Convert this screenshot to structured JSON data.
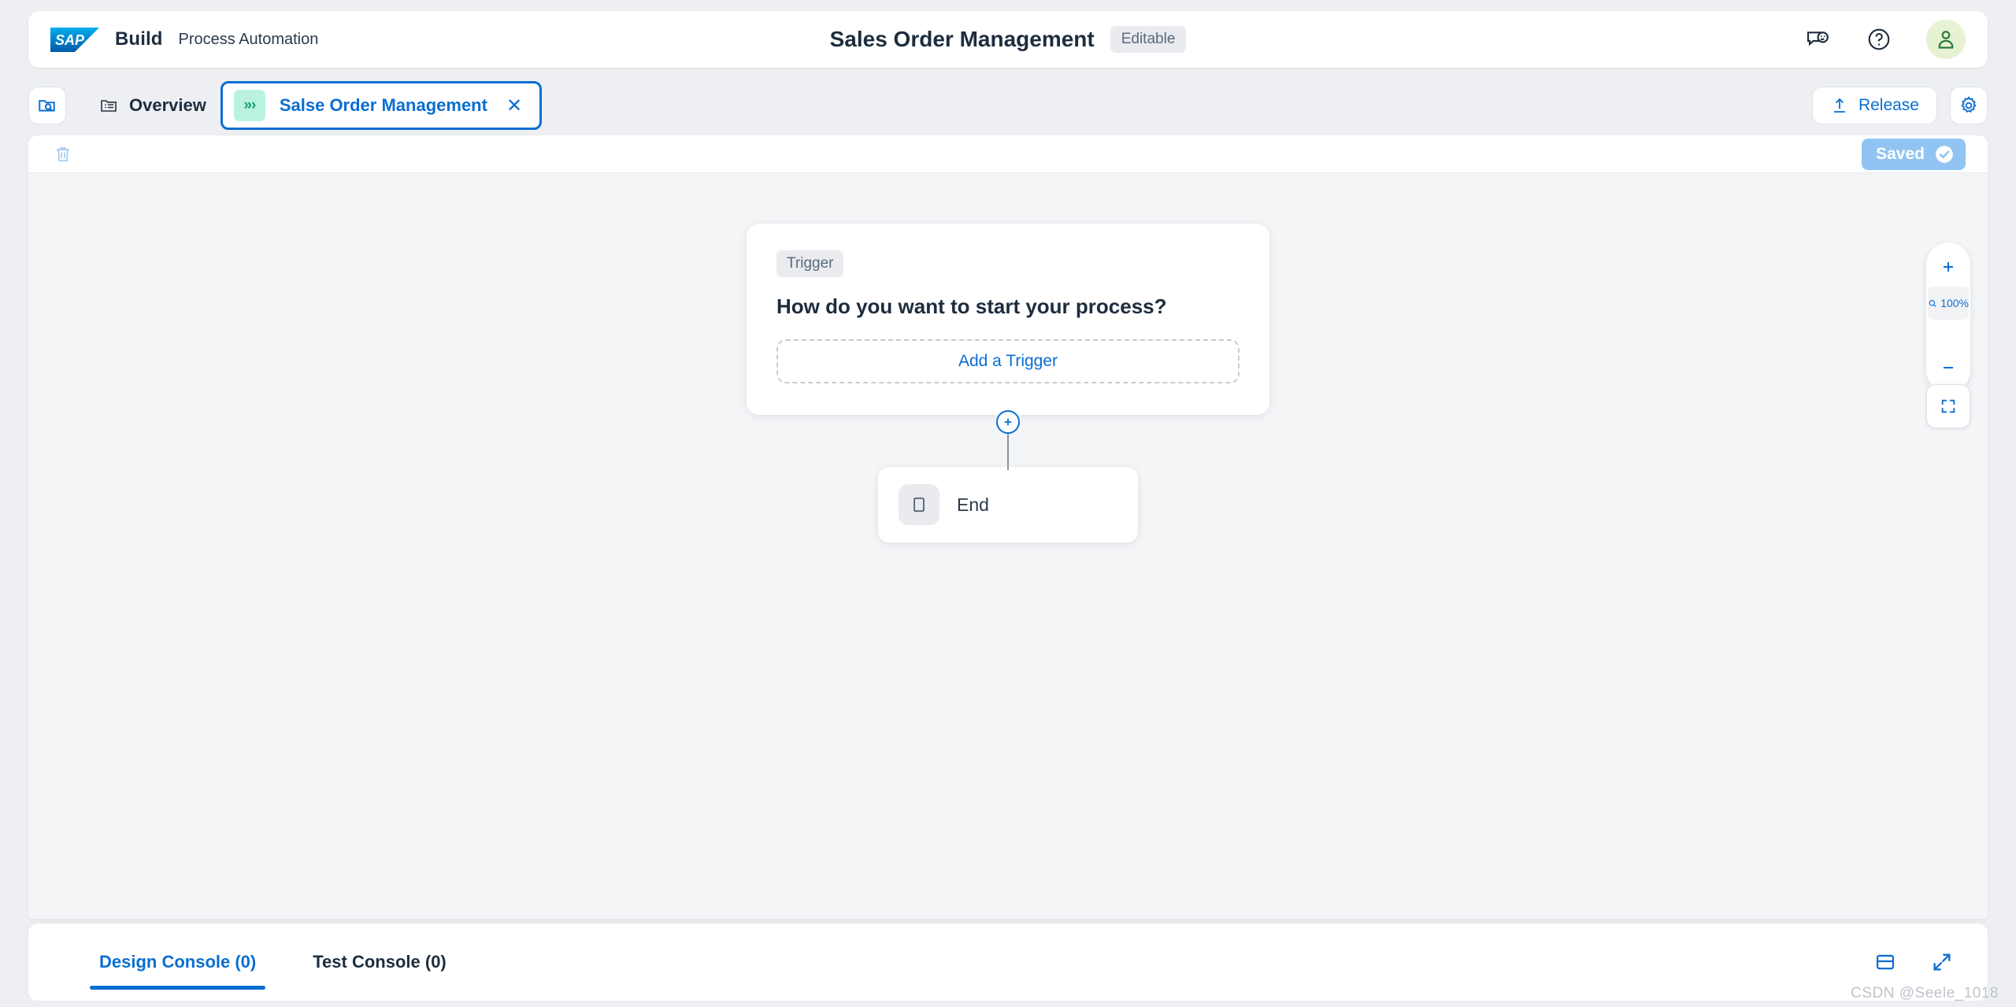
{
  "header": {
    "logo_alt": "SAP",
    "brand_name": "Build",
    "brand_sub": "Process Automation",
    "title": "Sales Order Management",
    "status_badge": "Editable",
    "icons": {
      "feedback": "feedback-icon",
      "help": "help-icon",
      "avatar": "user-avatar-icon"
    }
  },
  "tabstrip": {
    "explorer_icon": "project-explorer-icon",
    "tabs": [
      {
        "label": "Overview",
        "icon": "overview-folder-icon",
        "active": false
      },
      {
        "label": "Salse Order Management",
        "badge": "»›",
        "active": true,
        "close": "✕"
      }
    ],
    "release_label": "Release",
    "settings_icon": "gear-icon"
  },
  "editor": {
    "delete_icon": "trash-icon",
    "save_status": "Saved",
    "save_status_icon": "check-circle-icon"
  },
  "flow": {
    "trigger_card": {
      "chip": "Trigger",
      "title": "How do you want to start your process?",
      "add_button": "Add a Trigger"
    },
    "connector_icon": "plus-circle-icon",
    "end_node": {
      "label": "End",
      "icon": "end-node-icon"
    }
  },
  "zoom_controls": {
    "zoom_in": "plus-icon",
    "zoom_out": "minus-icon",
    "level": "100%",
    "level_icon": "magnifier-icon",
    "fit_to_screen": "fit-to-screen-icon"
  },
  "console": {
    "tabs": [
      {
        "label": "Design Console (0)",
        "active": true
      },
      {
        "label": "Test Console (0)",
        "active": false
      }
    ],
    "layout_icon": "split-panel-icon",
    "expand_icon": "expand-icon"
  },
  "watermark": "CSDN @Seele_1018",
  "colors": {
    "accent_blue": "#0A6ED1",
    "title_dark": "#1D2D3E",
    "chip_grey": "#E9EBEE",
    "saved_blue": "#91C4F2",
    "tab_badge_green": "#B9F3DE",
    "avatar_green": "#E6F2D2",
    "canvas_bg": "#F4F5F7",
    "page_bg": "#EDEFF2"
  }
}
